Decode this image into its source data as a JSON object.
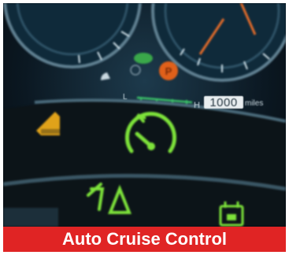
{
  "caption": "Auto Cruise Control",
  "odometer": {
    "value": "1000",
    "unit": "miles"
  },
  "fuel_gauge": {
    "low_label": "L",
    "high_label": "H"
  },
  "colors": {
    "banner": "#e02424",
    "indicator_green": "#7de23a",
    "indicator_amber": "#e0a21a",
    "indicator_orange": "#e0601a"
  },
  "icons": [
    "cruise-control-icon",
    "tpms-warning-icon",
    "hill-descent-icon",
    "parking-brake-icon",
    "traction-icon",
    "speedometer-gauge",
    "tachometer-gauge"
  ]
}
